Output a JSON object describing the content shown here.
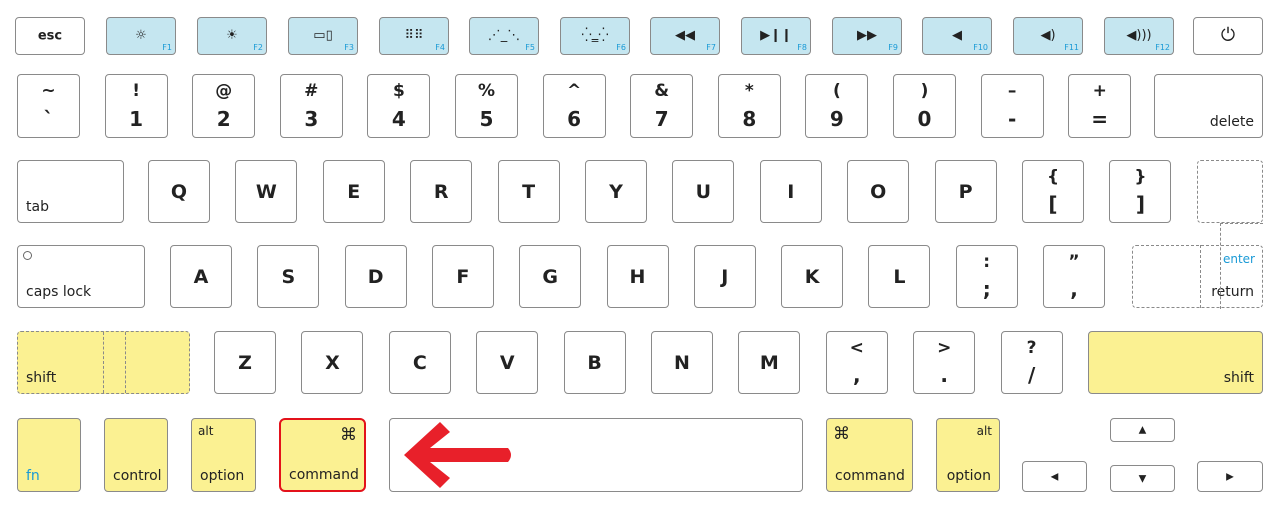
{
  "colors": {
    "function_keys": "#c5e6f0",
    "modifier_keys": "#fbf192",
    "highlight": "#e3121b",
    "fn_label": "#1a9ad6"
  },
  "function_row": [
    {
      "label": "esc"
    },
    {
      "fkey": "F1",
      "icon": "brightness-down-icon"
    },
    {
      "fkey": "F2",
      "icon": "brightness-up-icon"
    },
    {
      "fkey": "F3",
      "icon": "mission-control-icon"
    },
    {
      "fkey": "F4",
      "icon": "launchpad-icon"
    },
    {
      "fkey": "F5",
      "icon": "keyboard-light-down-icon"
    },
    {
      "fkey": "F6",
      "icon": "keyboard-light-up-icon"
    },
    {
      "fkey": "F7",
      "icon": "rewind-icon"
    },
    {
      "fkey": "F8",
      "icon": "play-pause-icon"
    },
    {
      "fkey": "F9",
      "icon": "fast-forward-icon"
    },
    {
      "fkey": "F10",
      "icon": "mute-icon"
    },
    {
      "fkey": "F11",
      "icon": "volume-down-icon"
    },
    {
      "fkey": "F12",
      "icon": "volume-up-icon"
    },
    {
      "icon": "power-icon"
    }
  ],
  "number_row": [
    {
      "top": "~",
      "bottom": "`"
    },
    {
      "top": "!",
      "bottom": "1"
    },
    {
      "top": "@",
      "bottom": "2"
    },
    {
      "top": "#",
      "bottom": "3"
    },
    {
      "top": "$",
      "bottom": "4"
    },
    {
      "top": "%",
      "bottom": "5"
    },
    {
      "top": "^",
      "bottom": "6"
    },
    {
      "top": "&",
      "bottom": "7"
    },
    {
      "top": "*",
      "bottom": "8"
    },
    {
      "top": "(",
      "bottom": "9"
    },
    {
      "top": ")",
      "bottom": "0"
    },
    {
      "top": "–",
      "bottom": "-"
    },
    {
      "top": "+",
      "bottom": "="
    },
    {
      "label": "delete"
    }
  ],
  "qwerty_row": [
    {
      "label": "tab"
    },
    {
      "char": "Q"
    },
    {
      "char": "W"
    },
    {
      "char": "E"
    },
    {
      "char": "R"
    },
    {
      "char": "T"
    },
    {
      "char": "Y"
    },
    {
      "char": "U"
    },
    {
      "char": "I"
    },
    {
      "char": "O"
    },
    {
      "char": "P"
    },
    {
      "top": "{",
      "bottom": "["
    },
    {
      "top": "}",
      "bottom": "]"
    }
  ],
  "home_row": [
    {
      "label": "caps lock"
    },
    {
      "char": "A"
    },
    {
      "char": "S"
    },
    {
      "char": "D"
    },
    {
      "char": "F"
    },
    {
      "char": "G"
    },
    {
      "char": "H"
    },
    {
      "char": "J"
    },
    {
      "char": "K"
    },
    {
      "char": "L"
    },
    {
      "top": ":",
      "bottom": ";"
    },
    {
      "top": "”",
      "bottom": ","
    }
  ],
  "return_key": {
    "top_label": "enter",
    "label": "return"
  },
  "shift_row": [
    {
      "label": "shift"
    },
    {
      "char": "Z"
    },
    {
      "char": "X"
    },
    {
      "char": "C"
    },
    {
      "char": "V"
    },
    {
      "char": "B"
    },
    {
      "char": "N"
    },
    {
      "char": "M"
    },
    {
      "top": "<",
      "bottom": ","
    },
    {
      "top": ">",
      "bottom": "."
    },
    {
      "top": "?",
      "bottom": "/"
    },
    {
      "label": "shift"
    }
  ],
  "bottom_row": [
    {
      "label": "fn"
    },
    {
      "label": "control"
    },
    {
      "top": "alt",
      "label": "option"
    },
    {
      "top": "⌘",
      "label": "command",
      "highlighted": true
    },
    {
      "label": ""
    },
    {
      "top": "⌘",
      "label": "command"
    },
    {
      "top": "alt",
      "label": "option"
    }
  ],
  "arrow_keys": [
    {
      "glyph": "▲",
      "name": "up"
    },
    {
      "glyph": "◀",
      "name": "left"
    },
    {
      "glyph": "▼",
      "name": "down"
    },
    {
      "glyph": "▶",
      "name": "right"
    }
  ],
  "annotation": {
    "icon": "red-arrow-left-icon",
    "points_to": "command"
  }
}
